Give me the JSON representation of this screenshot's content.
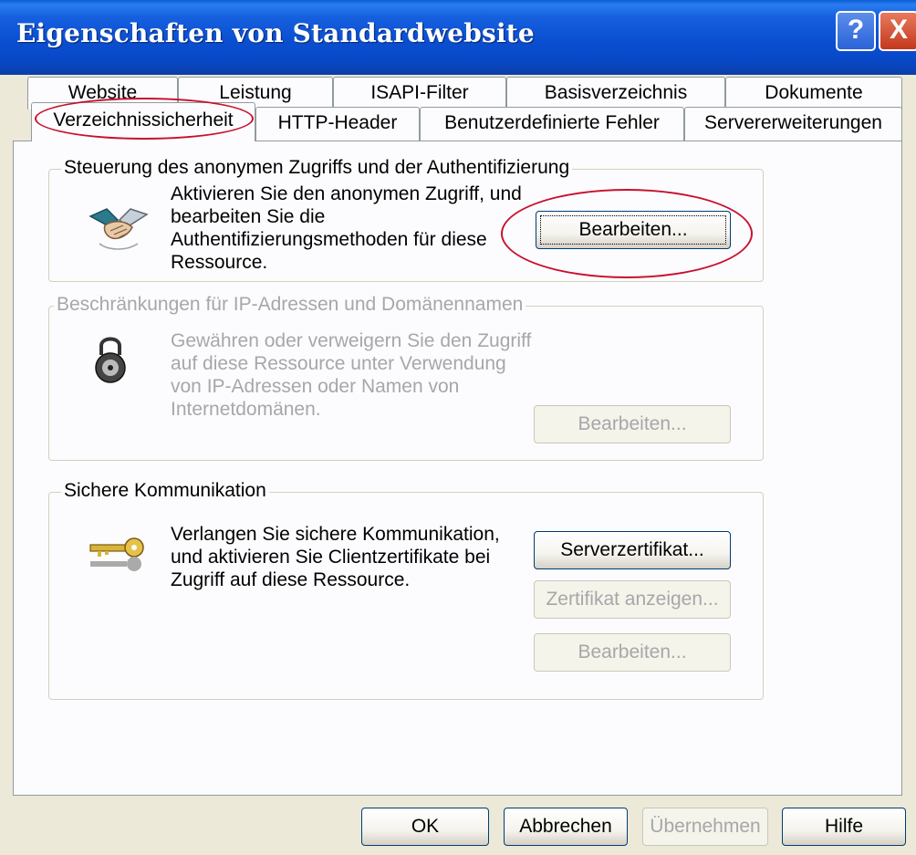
{
  "window": {
    "title": "Eigenschaften von Standardwebsite"
  },
  "titlebar": {
    "help_glyph": "?",
    "close_glyph": "X"
  },
  "tabs_back": [
    {
      "label": "Website"
    },
    {
      "label": "Leistung"
    },
    {
      "label": "ISAPI-Filter"
    },
    {
      "label": "Basisverzeichnis"
    },
    {
      "label": "Dokumente"
    }
  ],
  "tabs_front": [
    {
      "label": "Verzeichnissicherheit",
      "selected": true
    },
    {
      "label": "HTTP-Header"
    },
    {
      "label": "Benutzerdefinierte Fehler"
    },
    {
      "label": "Servererweiterungen"
    }
  ],
  "groups": {
    "auth": {
      "legend": "Steuerung des anonymen Zugriffs und der Authentifizierung",
      "desc_lines": [
        "Aktivieren Sie den anonymen Zugriff, und",
        "bearbeiten Sie die",
        "Authentifizierungsmethoden für diese",
        "Ressource."
      ],
      "button": "Bearbeiten...",
      "icon": "handshake-icon"
    },
    "ip": {
      "legend": "Beschränkungen für IP-Adressen und Domänennamen",
      "desc_lines": [
        "Gewähren oder verweigern Sie den Zugriff",
        "auf diese Ressource unter Verwendung",
        "von IP-Adressen oder Namen von",
        "Internetdomänen."
      ],
      "button": "Bearbeiten...",
      "icon": "padlock-icon",
      "disabled": true
    },
    "secure": {
      "legend": "Sichere Kommunikation",
      "desc_lines": [
        "Verlangen Sie sichere Kommunikation,",
        "und aktivieren Sie Clientzertifikate bei",
        "Zugriff auf diese Ressource."
      ],
      "buttons": [
        "Serverzertifikat...",
        "Zertifikat anzeigen...",
        "Bearbeiten..."
      ],
      "icon": "key-icon"
    }
  },
  "footer": {
    "ok": "OK",
    "cancel": "Abbrechen",
    "apply": "Übernehmen",
    "help": "Hilfe"
  },
  "colors": {
    "titlebar": "#0a4fd0",
    "dialog_bg": "#ece9d8",
    "annotation": "#c8102e"
  }
}
